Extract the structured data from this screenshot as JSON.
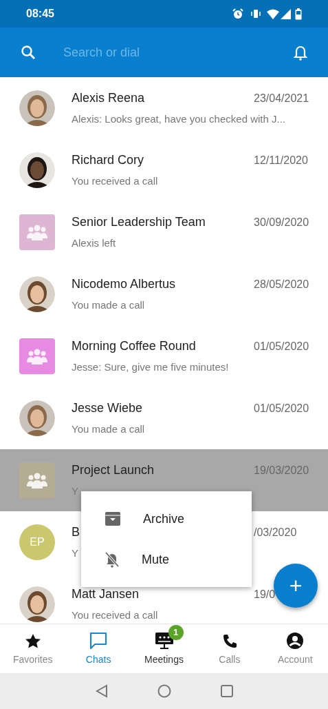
{
  "status_bar": {
    "time": "08:45"
  },
  "app_bar": {
    "search": {
      "placeholder": "Search or dial"
    }
  },
  "chats": [
    {
      "name": "Alexis Reena",
      "date": "23/04/2021",
      "preview": "Alexis: Looks great, have you checked with J...",
      "selected": false
    },
    {
      "name": "Richard Cory",
      "date": "12/11/2020",
      "preview": "You received a call",
      "selected": false
    },
    {
      "name": "Senior Leadership Team",
      "date": "30/09/2020",
      "preview": "Alexis left",
      "avatar": {
        "kind": "group",
        "color": "#dcb6d2"
      },
      "selected": false
    },
    {
      "name": "Nicodemo Albertus",
      "date": "28/05/2020",
      "preview": "You made a call",
      "selected": false
    },
    {
      "name": "Morning Coffee Round",
      "date": "01/05/2020",
      "preview": "Jesse: Sure, give me five minutes!",
      "avatar": {
        "kind": "group",
        "color": "#e68ae2"
      },
      "selected": false
    },
    {
      "name": "Jesse Wiebe",
      "date": "01/05/2020",
      "preview": "You made a call",
      "selected": false
    },
    {
      "name": "Project Launch",
      "date": "19/03/2020",
      "preview": "Y",
      "avatar": {
        "kind": "group",
        "color": "#b5ad93"
      },
      "selected": true
    },
    {
      "name": "B",
      "date": "/03/2020",
      "preview": "Y",
      "avatar": {
        "kind": "initials",
        "text": "EP",
        "color": "#cbc76c"
      },
      "selected": false
    },
    {
      "name": "Matt Jansen",
      "date": "19/0",
      "preview": "You received a call",
      "selected": false
    }
  ],
  "context_menu": [
    {
      "kind": "archive",
      "label": "Archive"
    },
    {
      "kind": "mute",
      "label": "Mute"
    }
  ],
  "fab": {
    "label": "+"
  },
  "bottom_nav": [
    {
      "kind": "star",
      "label": "Favorites",
      "selected": false,
      "emphasized": false
    },
    {
      "kind": "chat",
      "label": "Chats",
      "selected": true,
      "emphasized": false
    },
    {
      "kind": "meetings",
      "label": "Meetings",
      "selected": false,
      "emphasized": true,
      "badge": "1"
    },
    {
      "kind": "phone",
      "label": "Calls",
      "selected": false,
      "emphasized": false
    },
    {
      "kind": "account",
      "label": "Account",
      "selected": false,
      "emphasized": false
    }
  ]
}
